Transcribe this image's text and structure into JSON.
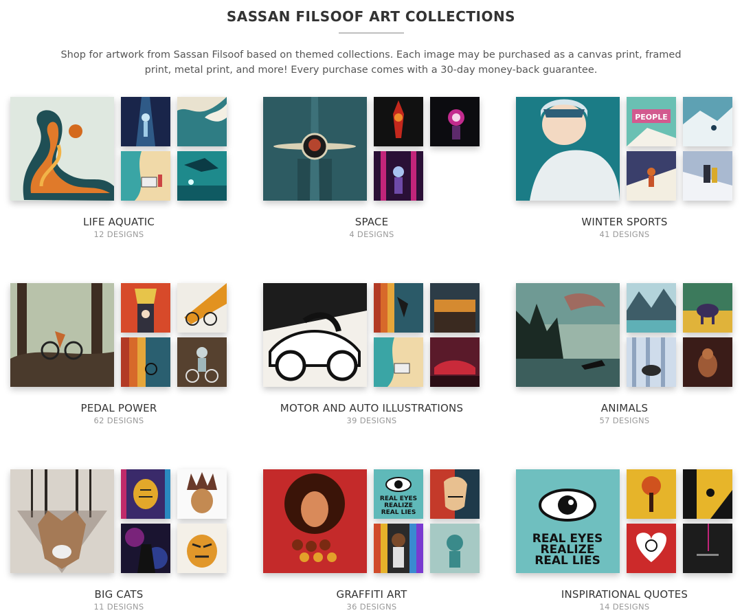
{
  "header": {
    "title": "SASSAN FILSOOF ART COLLECTIONS",
    "intro": "Shop for artwork from Sassan Filsoof based on themed collections. Each image may be purchased as a canvas print, framed print, metal print, and more! Every purchase comes with a 30-day money-back guarantee."
  },
  "collections": [
    {
      "name": "LIFE AQUATIC",
      "count": "12 DESIGNS"
    },
    {
      "name": "SPACE",
      "count": "4 DESIGNS"
    },
    {
      "name": "WINTER SPORTS",
      "count": "41 DESIGNS"
    },
    {
      "name": "PEDAL POWER",
      "count": "62 DESIGNS"
    },
    {
      "name": "MOTOR AND AUTO ILLUSTRATIONS",
      "count": "39 DESIGNS"
    },
    {
      "name": "ANIMALS",
      "count": "57 DESIGNS"
    },
    {
      "name": "BIG CATS",
      "count": "11 DESIGNS"
    },
    {
      "name": "GRAFFITI ART",
      "count": "36 DESIGNS"
    },
    {
      "name": "INSPIRATIONAL QUOTES",
      "count": "14 DESIGNS"
    }
  ],
  "artwork_text": {
    "quote_line1": "REAL EYES",
    "quote_line2": "REALIZE",
    "quote_line3": "REAL LIES",
    "people_sign": "PEOPLE"
  }
}
